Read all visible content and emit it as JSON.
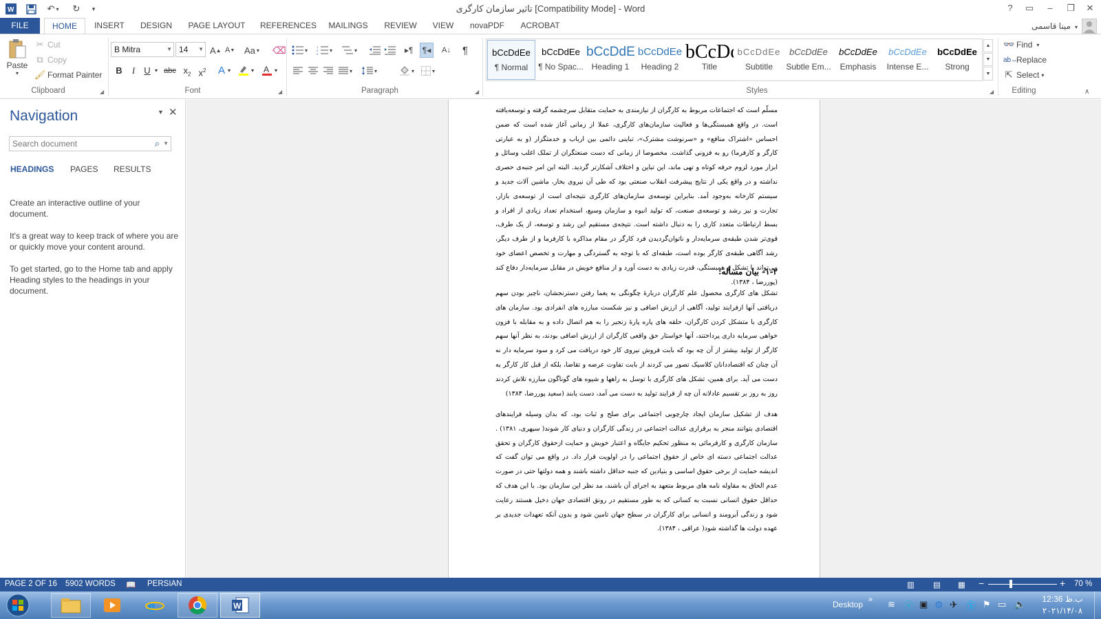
{
  "title_bar": {
    "title": "تاثیر سازمان کارگری [Compatibility Mode] - Word",
    "help": "?",
    "minimize": "–",
    "restore": "❐",
    "close": "✕"
  },
  "tabs": [
    "FILE",
    "HOME",
    "INSERT",
    "DESIGN",
    "PAGE LAYOUT",
    "REFERENCES",
    "MAILINGS",
    "REVIEW",
    "VIEW",
    "novaPDF",
    "ACROBAT"
  ],
  "user": {
    "name": "مینا قاسمی"
  },
  "clipboard": {
    "paste": "Paste",
    "cut": "Cut",
    "copy": "Copy",
    "format_painter": "Format Painter",
    "label": "Clipboard"
  },
  "font": {
    "name": "B Mitra",
    "size": "14",
    "label": "Font"
  },
  "paragraph": {
    "label": "Paragraph"
  },
  "styles": {
    "label": "Styles",
    "items": [
      {
        "preview": "bCcDdEe",
        "name": "¶ Normal"
      },
      {
        "preview": "bCcDdEe",
        "name": "¶ No Spac..."
      },
      {
        "preview": "bCcDdEe",
        "name": "Heading 1"
      },
      {
        "preview": "bCcDdEe",
        "name": "Heading 2"
      },
      {
        "preview": "bCcDdEe",
        "name": "Title"
      },
      {
        "preview": "bCcDdEe",
        "name": "Subtitle"
      },
      {
        "preview": "bCcDdEe",
        "name": "Subtle Em..."
      },
      {
        "preview": "bCcDdEe",
        "name": "Emphasis"
      },
      {
        "preview": "bCcDdEe",
        "name": "Intense E..."
      },
      {
        "preview": "bCcDdEe",
        "name": "Strong"
      }
    ]
  },
  "editing": {
    "find": "Find",
    "replace": "Replace",
    "select": "Select",
    "label": "Editing"
  },
  "navigation": {
    "title": "Navigation",
    "search_placeholder": "Search document",
    "tabs": [
      "HEADINGS",
      "PAGES",
      "RESULTS"
    ],
    "paragraphs": [
      "Create an interactive outline of your document.",
      "It's a great way to keep track of where you are or quickly move your content around.",
      "To get started, go to the Home tab and apply Heading styles to the headings in your document."
    ]
  },
  "document": {
    "para1": "مسلّم است که اجتماعات مربوط به کارگران از نیازمندی به حمایت متقابل سرچشمه گرفته و توسعه‌یافته است. در واقع همبستگی‌ها و فعالیت سازمان‌های کارگری، عملا از زمانی آغاز شده است که ضمن احساس «اشتراک منافع» و «سرنوشت مشترک»، تباینی دائمی بین ارباب و خدمتگزار (و به عبارتی کارگر و کارفرما) رو به فزونی گذاشت. مخصوصا از زمانی که دست صنعتگران از تملک اغلب وسائل و ابزار مورد لزوم حرفه کوتاه و تهی ماند، این تباین و اختلاف آشکارتر گردید. البته این امر جنبه‌ی حصری نداشته و در واقع یکی از نتایج پیشرفت انقلاب صنعتی بود که طی آن نیروی بخار، ماشین آلات جدید و سیستم کارخانه به‌وجود آمد. بنابراین توسعه‌ی سازمان‌های کارگری نتیجه‌ای است از توسعه‌ی بازار، تجارت و نیز رشد و توسعه‌ی صنعت، که تولید انبوه و سازمان وسیع، استخدام تعداد زیادی از افراد و بسط ارتباطات متعدد کاری را به دنبال داشته است. نتیجه‌ی مستقیم این رشد و توسعه، از یک طرف، قوی‌تر شدن طبقه‌ی سرمایه‌دار و ناتوان‌گردیدن فرد کارگر در مقام مذاکره با کارفرما و از طرف دیگر، رشد آگاهی طبقه‌ی کارگر بوده است، طبقه‌ای که با توجه به گستردگی و مهارت و تخصص اعضای خود می‌تواند با تشکل و همبستگی، قدرت زیادی به دست آورد و از منافع خویش در مقابل سرمایه‌دار دفاع کند (پوررضا ، ۱۳۸۴).",
    "heading": "۱-۲- بیان مسأله:",
    "para2": "تشکل های کارگری محصول علم کارگران دربارۀ چگونگی به یغما رفتن دسترنجشان، ناچیز بودن سهم دریافتی آنها ازفرایند تولید، آگاهی از ارزش اضافی و نیز شکست مبارزه های انفرادی بود. سازمان های کارگری با متشکل کردن کارگران، حلقه های پاره پارۀ زنجیر را به هم اتصال داده و به مقابله با فزون خواهی سرمایه داری پرداختند، آنها خواستار حق واقعی کارگران از ارزش اضافی بودند، به نظر آنها سهم کارگر از تولید بیشتر از آن چه بود که بابت فروش نیروی کار خود دریافت می کرد و سود سرمایه دار نه آن چنان که اقتصاددانان کلاسیک تصور می کردند از بابت تفاوت عرضه و تقاضا، بلکه از قبل کار کارگر به دست می آید. برای همین، تشکل های کارگری با توسل به راهها و شیوه های گوناگون مبارزه تلاش کردند روز به روز بر تقسیم عادلانه آن چه از فرایند تولید به دست می آمد، دست یابند (سعید پوررضا، ۱۳۸۴)",
    "para3": "هدف از تشکیل سازمان ایجاد چارچوبی اجتماعی برای صلح و ثبات بود، که بدان وسیله فرایندهای اقتصادی بتوانند منجر به برقراری عدالت اجتماعی در زندگی کارگران و دنیای کار شوند( سپهری، ۱۳۸۱) . سازمان کارگری و کارفرمائی به منظور تحکیم جایگاه و اعتبار خویش و حمایت ازحقوق کارگران و تحقق عدالت اجتماعی دسته ای خاص از حقوق اجتماعی را در اولویت قرار داد. در واقع می توان گفت که اندیشه حمایت از برخی حقوق اساسی و بنیادین که جنبه حداقل داشته باشند و همه دولتها حتی در صورت عدم الحاق به مقاوله نامه های مربوط متعهد به اجرای آن باشند، مد نظر این سازمان بود. با این هدف که حداقل حقوق انسانی نسبت به کسانی که به طور مستقیم در رونق اقتصادی جهان دخیل هستند رعایت شود و زندگی آبرومند و انسانی برای کارگران در سطح جهان تامین شود و بدون آنکه تعهدات جدیدی بر عهده دولت ها گذاشته شود( عراقی ، ۱۳۸۴)."
  },
  "status": {
    "page": "PAGE 2 OF 16",
    "words": "5902 WORDS",
    "language": "PERSIAN",
    "zoom": "70 %",
    "zoom_level": 0.7
  },
  "taskbar": {
    "desktop": "Desktop",
    "time": "12:36 ب.ظ",
    "date": "۲۰۲۱/۱۴/۰۸"
  },
  "colors": {
    "accent": "#2b579a",
    "taskbar": "#6a98cf"
  }
}
